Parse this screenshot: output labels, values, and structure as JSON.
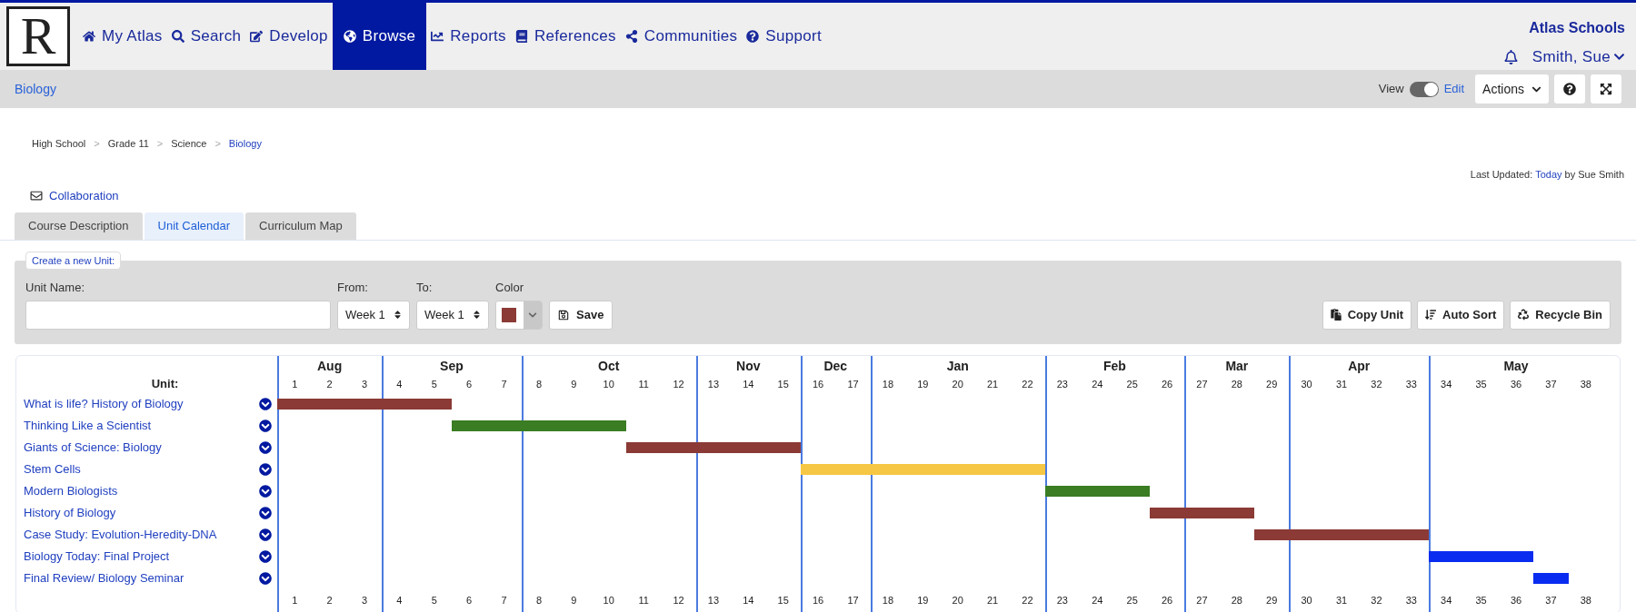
{
  "logo": {
    "letter": "R"
  },
  "nav": [
    {
      "label": "My Atlas",
      "selected": false
    },
    {
      "label": "Search",
      "selected": false
    },
    {
      "label": "Develop",
      "selected": false
    },
    {
      "label": "Browse",
      "selected": true
    },
    {
      "label": "Reports",
      "selected": false
    },
    {
      "label": "References",
      "selected": false
    },
    {
      "label": "Communities",
      "selected": false
    },
    {
      "label": "Support",
      "selected": false
    }
  ],
  "account": {
    "org": "Atlas Schools",
    "user": "Smith, Sue"
  },
  "subbar": {
    "title": "Biology",
    "toggle": {
      "left": "View",
      "right": "Edit",
      "on": true
    },
    "actions": "Actions"
  },
  "breadcrumb": {
    "separator": ">",
    "items": [
      {
        "label": "High School",
        "current": false
      },
      {
        "label": "Grade 11",
        "current": false
      },
      {
        "label": "Science",
        "current": false
      },
      {
        "label": "Biology",
        "current": true
      }
    ]
  },
  "last_updated": {
    "prefix": "Last Updated:",
    "link": "Today",
    "suffix": "by Sue Smith"
  },
  "collaboration": "Collaboration",
  "tabs": [
    {
      "label": "Course Description",
      "selected": false
    },
    {
      "label": "Unit Calendar",
      "selected": true
    },
    {
      "label": "Curriculum Map",
      "selected": false
    }
  ],
  "create_unit": {
    "legend": "Create a new Unit:",
    "name_label": "Unit Name:",
    "from_label": "From:",
    "from_value": "Week 1",
    "to_label": "To:",
    "to_value": "Week 1",
    "color_label": "Color",
    "color": "#8b3a36",
    "save": "Save",
    "buttons": [
      {
        "label": "Copy Unit"
      },
      {
        "label": "Auto Sort"
      },
      {
        "label": "Recycle Bin"
      }
    ]
  },
  "calendar": {
    "unit_heading": "Unit:",
    "months": [
      {
        "label": "Aug",
        "weeks": [
          "1",
          "2",
          "3"
        ]
      },
      {
        "label": "Sep",
        "weeks": [
          "4",
          "5",
          "6",
          "7"
        ]
      },
      {
        "label": "Oct",
        "weeks": [
          "8",
          "9",
          "10",
          "11",
          "12"
        ]
      },
      {
        "label": "Nov",
        "weeks": [
          "13",
          "14",
          "15"
        ]
      },
      {
        "label": "Dec",
        "weeks": [
          "16",
          "17"
        ]
      },
      {
        "label": "Jan",
        "weeks": [
          "18",
          "19",
          "20",
          "21",
          "22"
        ]
      },
      {
        "label": "Feb",
        "weeks": [
          "23",
          "24",
          "25",
          "26"
        ]
      },
      {
        "label": "Mar",
        "weeks": [
          "27",
          "28",
          "29"
        ]
      },
      {
        "label": "Apr",
        "weeks": [
          "30",
          "31",
          "32",
          "33"
        ]
      },
      {
        "label": "May",
        "weeks": [
          "34",
          "35",
          "36",
          "37",
          "38"
        ]
      }
    ],
    "units": [
      {
        "name": "What is life? History of Biology",
        "color": "#8b3a36"
      },
      {
        "name": "Thinking Like a Scientist",
        "color": "#3a7d23"
      },
      {
        "name": "Giants of Science: Biology",
        "color": "#8b3a36"
      },
      {
        "name": "Stem Cells",
        "color": "#f6c744"
      },
      {
        "name": "Modern Biologists",
        "color": "#3a7d23"
      },
      {
        "name": "History of Biology",
        "color": "#8b3a36"
      },
      {
        "name": "Case Study: Evolution-Heredity-DNA",
        "color": "#8b3a36"
      },
      {
        "name": "Biology Today: Final Project",
        "color": "#0a2cf0"
      },
      {
        "name": "Final Review/ Biology Seminar",
        "color": "#0a2cf0"
      }
    ],
    "bottom_weeks": [
      "1",
      "2",
      "3",
      "4",
      "5",
      "6",
      "7",
      "8",
      "9",
      "10",
      "11",
      "12",
      "13",
      "14",
      "15",
      "16",
      "17",
      "18",
      "19",
      "20",
      "21",
      "22",
      "23",
      "24",
      "25",
      "26",
      "27",
      "28",
      "29",
      "30",
      "31",
      "32",
      "33",
      "34",
      "35",
      "36",
      "37",
      "38"
    ]
  }
}
